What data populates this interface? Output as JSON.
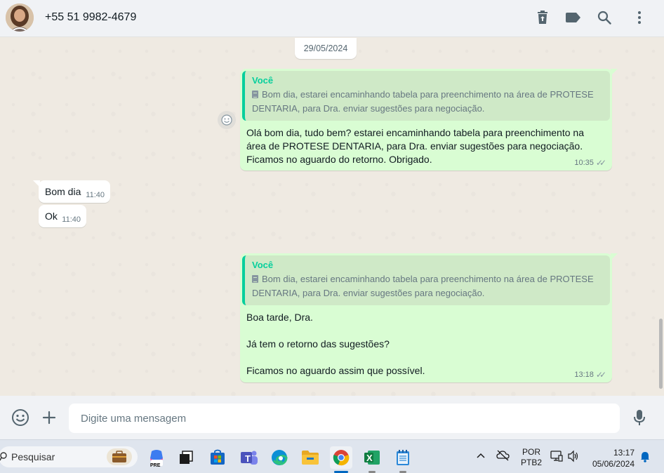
{
  "header": {
    "contact_name": "+55 51 9982-4679",
    "icons": [
      "delete-icon",
      "label-icon",
      "search-icon",
      "menu-icon"
    ]
  },
  "chat": {
    "date_chip": "29/05/2024",
    "messages": [
      {
        "direction": "outgoing",
        "quote_author": "Você",
        "quote_text": "Bom dia, estarei encaminhando tabela para preenchimento na área de PROTESE DENTARIA, para Dra. enviar sugestões para negociação.",
        "text": "Olá bom dia, tudo bem? estarei encaminhando tabela para preenchimento na área de PROTESE DENTARIA, para Dra. enviar sugestões para negociação. Ficamos no aguardo do retorno. Obrigado.",
        "time": "10:35",
        "status": "read"
      },
      {
        "direction": "incoming",
        "text": "Bom dia",
        "time": "11:40"
      },
      {
        "direction": "incoming",
        "text": "Ok",
        "time": "11:40"
      },
      {
        "direction": "outgoing",
        "quote_author": "Você",
        "quote_text": "Bom dia, estarei encaminhando tabela para preenchimento na área de PROTESE DENTARIA, para Dra. enviar sugestões para negociação.",
        "text": "Boa tarde, Dra.\n\nJá tem o retorno das sugestões?\n\nFicamos no aguardo assim que possível.",
        "time": "13:18",
        "status": "read"
      }
    ]
  },
  "composer": {
    "placeholder": "Digite uma mensagem"
  },
  "taskbar": {
    "search_text": "Pesquisar",
    "apps": [
      "copilot-icon",
      "task-view-icon",
      "microsoft-store-icon",
      "teams-icon",
      "edge-icon",
      "file-explorer-icon",
      "chrome-icon",
      "excel-icon",
      "notepad-icon"
    ],
    "copilot_badge": "PRE",
    "teams_badge": "T",
    "excel_badge": "X",
    "language": "POR",
    "keyboard": "PTB2",
    "time": "13:17",
    "date": "05/06/2024"
  },
  "colors": {
    "outgoing_bubble": "#d9fdd3",
    "incoming_bubble": "#ffffff",
    "accent": "#06cf9c",
    "chat_bg": "#efeae2",
    "header_bg": "#f0f2f5"
  }
}
